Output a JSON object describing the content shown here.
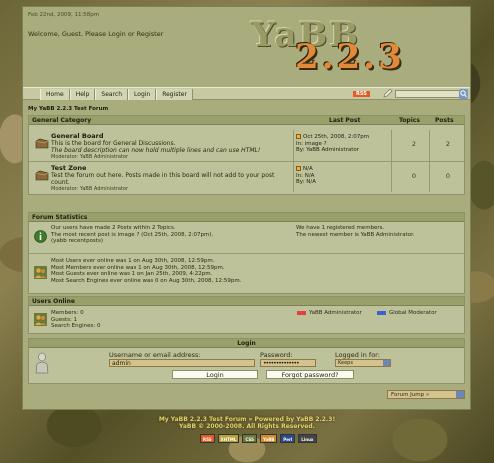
{
  "header": {
    "date": "Feb 22nd, 2009, 11:58pm",
    "welcome_prefix": "Welcome, Guest. Please ",
    "login_link": "Login",
    "or": " or ",
    "register_link": "Register",
    "logo_top": "YaBB",
    "logo_bottom": "2.2.3"
  },
  "nav": {
    "items": [
      "Home",
      "Help",
      "Search",
      "Login",
      "Register"
    ],
    "rss": "RSS"
  },
  "breadcrumb": "My YaBB 2.2.3 Test Forum",
  "categories": {
    "title": "General Category",
    "col_last_post": "Last Post",
    "col_topics": "Topics",
    "col_posts": "Posts",
    "boards": [
      {
        "title": "General Board",
        "desc": "This is the board for General Discussions.",
        "desc2": "The board description can now hold multiple lines and can use HTML!",
        "moderator": "Moderator: YaBB Administrator",
        "last_line1": "Oct 25th, 2008, 2:07pm",
        "last_line2": "In: image ?",
        "last_line3": "By: YaBB Administrator",
        "topics": "2",
        "posts": "2"
      },
      {
        "title": "Test Zone",
        "desc": "Test the forum out here. Posts made in this board will not add to your post count.",
        "desc2": "",
        "moderator": "Moderator: YaBB Administrator",
        "last_line1": "N/A",
        "last_line2": "In: N/A",
        "last_line3": "By: N/A",
        "topics": "0",
        "posts": "0"
      }
    ]
  },
  "stats": {
    "title": "Forum Statistics",
    "line1": "Our users have made 2 Posts within 2 Topics.",
    "line2": "The most recent post is image ? (Oct 25th, 2008, 2:07pm).",
    "line3": "(yabb recentposts)",
    "right1": "We have 1 registered members.",
    "right2": "The newest member is YaBB Administrator.",
    "online1": "Most Users ever online was 1 on Aug 30th, 2008, 12:59pm.",
    "online2": "Most Members ever online was 1 on Aug 30th, 2008, 12:59pm.",
    "online3": "Most Guests ever online was 1 on Jan 25th, 2009, 4:22pm.",
    "online4": "Most Search Engines ever online was 0 on Aug 30th, 2008, 12:59pm."
  },
  "users_online": {
    "title": "Users Online",
    "members": "Members: 0",
    "guests": "Guests: 1",
    "search_engines": "Search Engines: 0",
    "legend_admin": "YaBB Administrator",
    "legend_global": "Global Moderator",
    "admin_color": "#e04040",
    "global_color": "#4060d0"
  },
  "login": {
    "title": "Login",
    "username_label": "Username or email address:",
    "username_value": "admin",
    "password_label": "Password:",
    "password_value": "••••••••••••••",
    "logged_label": "Logged in for:",
    "logged_value": "Keeps",
    "login_button": "Login",
    "forgot_button": "Forgot password?"
  },
  "forum_jump": "Forum Jump »",
  "footer": {
    "line1": "My YaBB 2.2.3 Test Forum » Powered by YaBB 2.2.3!",
    "line2": "YaBB © 2000-2008. All Rights Reserved.",
    "badges": [
      "RSS",
      "XHTML",
      "CSS",
      "YaBB",
      "Perl",
      "Linux"
    ]
  }
}
